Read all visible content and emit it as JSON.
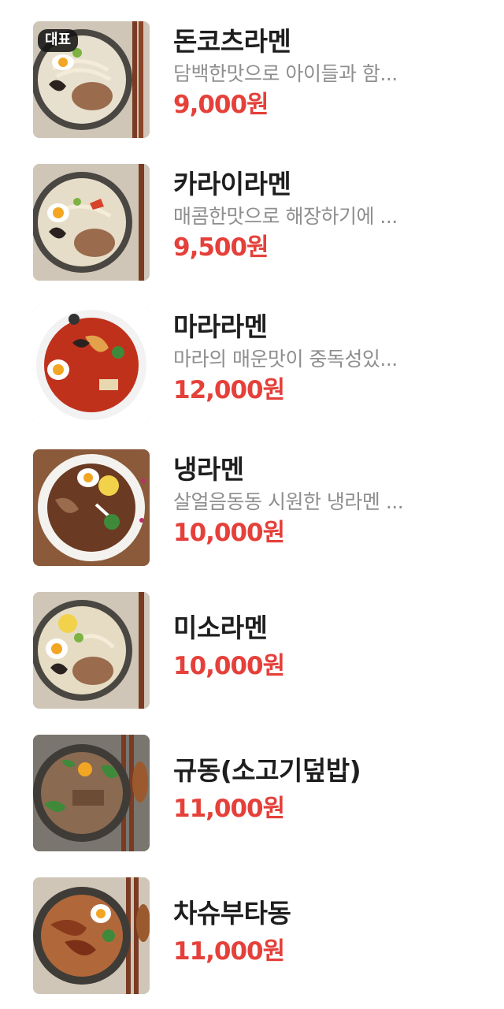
{
  "menu": {
    "items": [
      {
        "name": "돈코츠라멘",
        "description": "담백한맛으로 아이들과 함...",
        "price": "9,000원",
        "badge": "대표",
        "image_icon": "tonkotsu-ramen-photo"
      },
      {
        "name": "카라이라멘",
        "description": "매콤한맛으로 해장하기에 ...",
        "price": "9,500원",
        "image_icon": "karai-ramen-photo"
      },
      {
        "name": "마라라멘",
        "description": "마라의 매운맛이 중독성있...",
        "price": "12,000원",
        "image_icon": "mala-ramen-photo"
      },
      {
        "name": "냉라멘",
        "description": "살얼음동동 시원한 냉라멘 ...",
        "price": "10,000원",
        "image_icon": "cold-ramen-photo"
      },
      {
        "name": "미소라멘",
        "price": "10,000원",
        "image_icon": "miso-ramen-photo"
      },
      {
        "name": "규동(소고기덮밥)",
        "price": "11,000원",
        "image_icon": "gyudon-photo"
      },
      {
        "name": "차슈부타동",
        "price": "11,000원",
        "image_icon": "chashu-butadon-photo"
      }
    ]
  },
  "colors": {
    "price": "#e5403a",
    "name": "#1e1e1e",
    "description": "#8e8e8e",
    "badge_bg": "#141414"
  }
}
